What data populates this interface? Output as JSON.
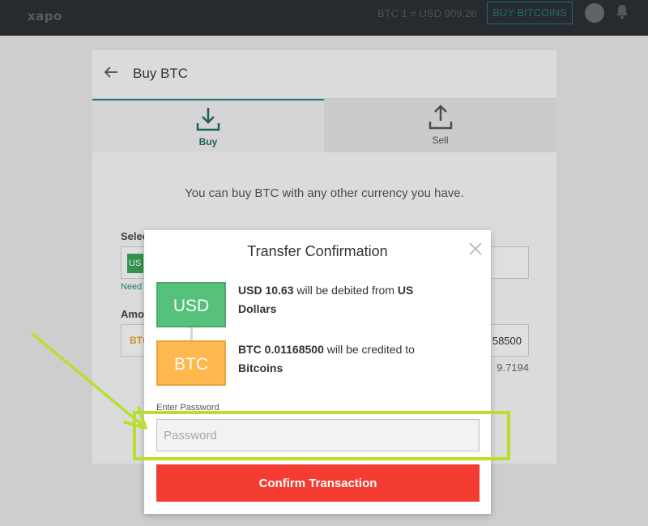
{
  "topbar": {
    "logo": "xapo",
    "rate": "BTC 1 = USD 909.26",
    "buy_button": "BUY BITCOINS",
    "icons": [
      "avatar",
      "bell-icon"
    ]
  },
  "background_page": {
    "title": "Buy BTC",
    "tabs": [
      {
        "label": "Buy",
        "icon": "download-icon",
        "active": true
      },
      {
        "label": "Sell",
        "icon": "upload-icon",
        "active": false
      }
    ],
    "description": "You can buy BTC with any other currency you have.",
    "select_label_fragment": "Selec",
    "select_chip_fragment": "US",
    "need_link_fragment": "Need",
    "amount_label_fragment": "Amou",
    "amount_currency_fragment": "BTC",
    "amount_value_fragment": "58500",
    "sub_value_fragment": "9.7194"
  },
  "modal": {
    "title": "Transfer Confirmation",
    "usd_chip": "USD",
    "btc_chip": "BTC",
    "debit": {
      "amount": "USD 10.63",
      "middle": " will be debited from ",
      "account": "US Dollars"
    },
    "credit": {
      "amount": "BTC 0.01168500",
      "middle": " will be credited to ",
      "account": "Bitcoins"
    },
    "password_label": "Enter Password",
    "password_placeholder": "Password",
    "confirm_button": "Confirm Transaction"
  },
  "colors": {
    "topbar": "#262b30",
    "accent_teal": "#1f6b66",
    "usd_chip": "#55c17a",
    "btc_chip": "#ffb84d",
    "confirm_button": "#f53c32",
    "annotation": "#b8e02b"
  }
}
